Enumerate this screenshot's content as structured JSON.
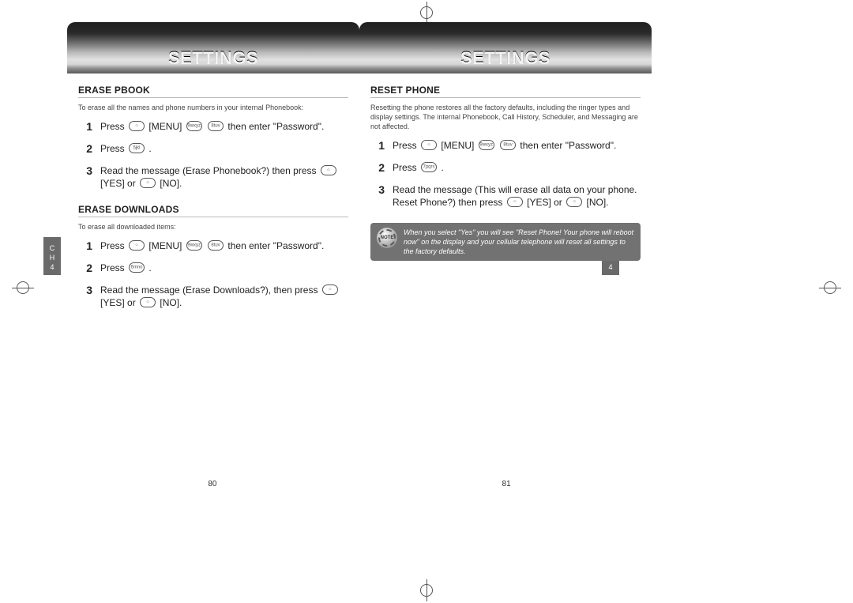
{
  "header": {
    "title_left": "Settings",
    "title_right": "Settings"
  },
  "chapter_tab": {
    "left": "C\nH\n4",
    "right": "C\nH\n4"
  },
  "page_numbers": {
    "left": "80",
    "right": "81"
  },
  "left_page": {
    "sections": [
      {
        "heading": "ERASE PBOOK",
        "intro": "To erase all the names and phone numbers in your internal Phonebook:",
        "steps": [
          {
            "n": "1",
            "pre": "Press ",
            "k1": "○",
            "mid1": " [MENU] ",
            "k2": "9wxyz",
            "mid2": " ",
            "k3": "8tuv",
            "post": " then enter \"Password\"."
          },
          {
            "n": "2",
            "pre": "Press ",
            "k1": "5jkl",
            "post_plain": " ."
          },
          {
            "n": "3",
            "pre": "Read the message (Erase Phonebook?) then press ",
            "k1": "○",
            "mid1": " [YES] or ",
            "k2": "○",
            "post": " [NO]."
          }
        ]
      },
      {
        "heading": "ERASE DOWNLOADS",
        "intro": "To erase all downloaded items:",
        "steps": [
          {
            "n": "1",
            "pre": "Press ",
            "k1": "○",
            "mid1": " [MENU] ",
            "k2": "9wxyz",
            "mid2": " ",
            "k3": "8tuv",
            "post": " then enter \"Password\"."
          },
          {
            "n": "2",
            "pre": "Press ",
            "k1": "6mno",
            "post_plain": " ."
          },
          {
            "n": "3",
            "pre": "Read the message (Erase Downloads?), then press ",
            "k1": "○",
            "mid1": " [YES] or ",
            "k2": "○",
            "post": " [NO]."
          }
        ]
      }
    ]
  },
  "right_page": {
    "sections": [
      {
        "heading": "RESET PHONE",
        "intro": "Resetting the phone restores all the factory defaults, including the ringer types and display settings. The internal Phonebook, Call History, Scheduler, and Messaging are not affected.",
        "steps": [
          {
            "n": "1",
            "pre": "Press ",
            "k1": "○",
            "mid1": " [MENU] ",
            "k2": "9wxyz",
            "mid2": " ",
            "k3": "8tuv",
            "post": " then enter \"Password\"."
          },
          {
            "n": "2",
            "pre": "Press ",
            "k1": "7pqrs",
            "post_plain": " ."
          },
          {
            "n": "3",
            "pre": "Read the message (This will erase all data on your phone. Reset Phone?) then press ",
            "k1": "○",
            "mid1": " [YES] or ",
            "k2": "○",
            "post": " [NO]."
          }
        ]
      }
    ],
    "note": {
      "label": "NOTE",
      "text": "When you select \"Yes\" you will see \"Reset Phone!  Your phone will reboot now\" on the display and your cellular telephone will reset all settings to the factory defaults."
    }
  }
}
